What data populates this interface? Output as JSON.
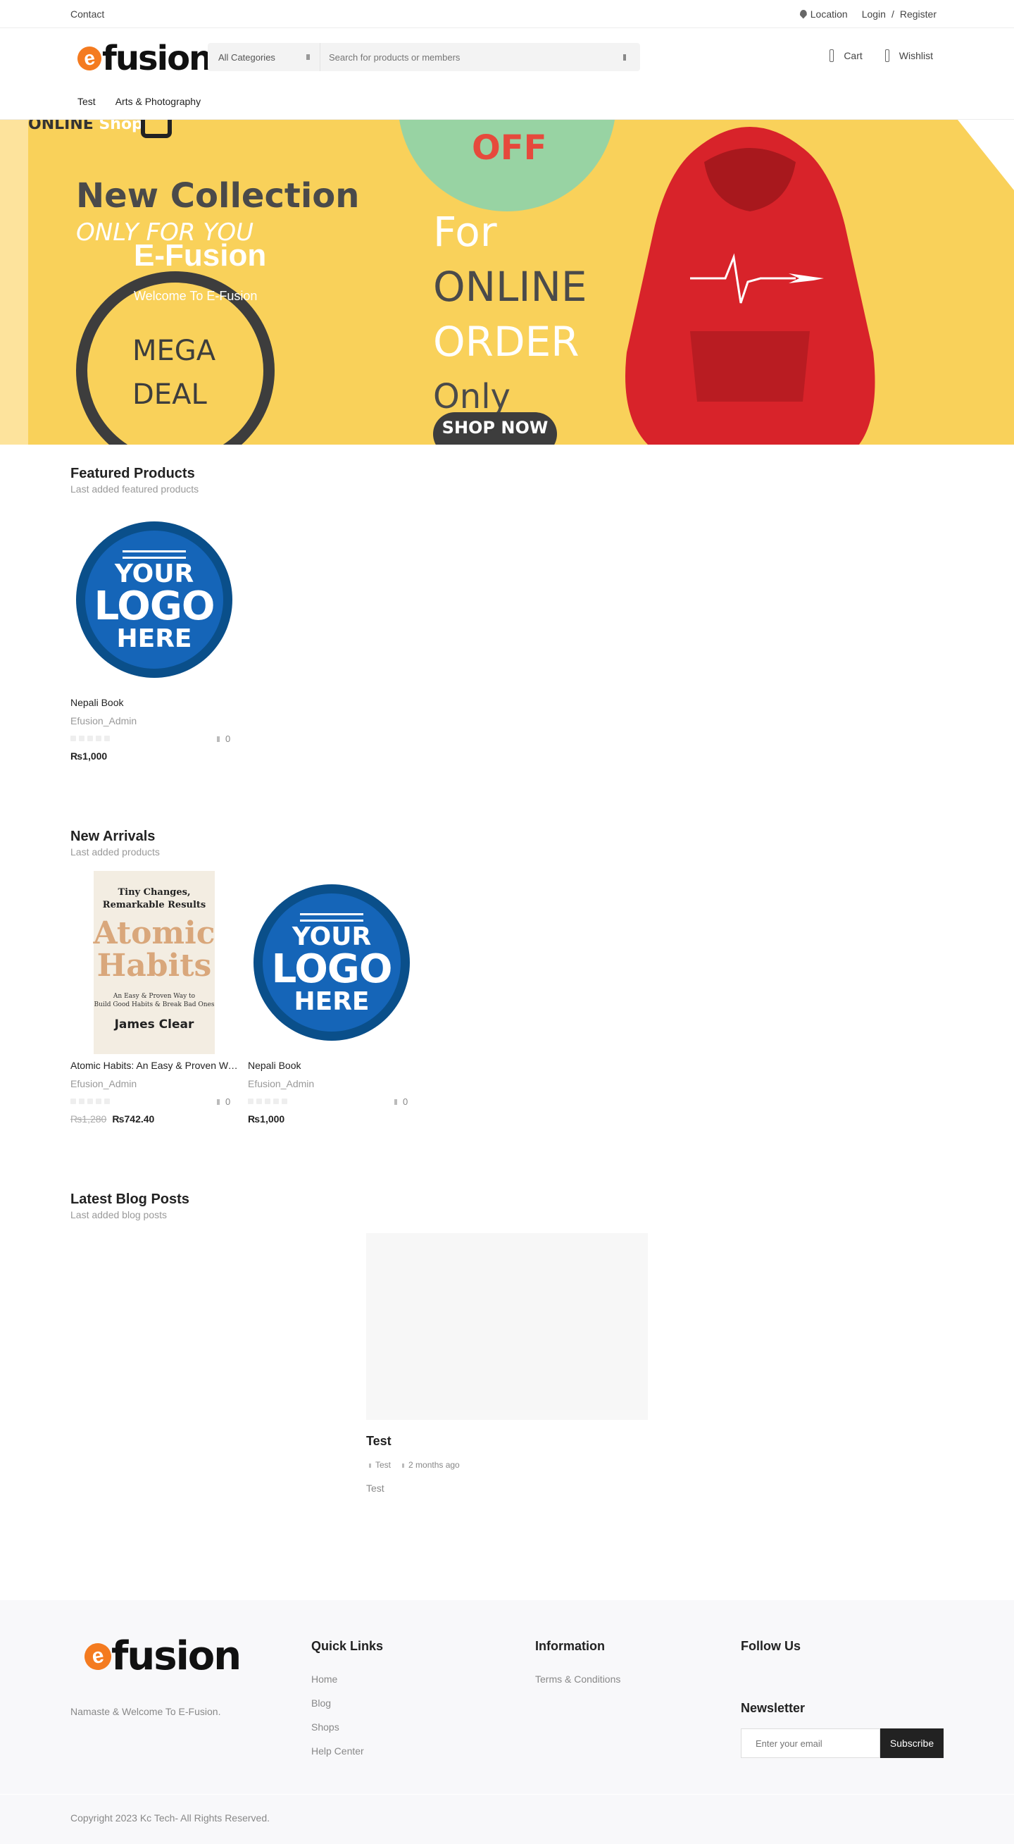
{
  "topbar": {
    "contact": "Contact",
    "location": "Location",
    "login": "Login",
    "separator": "/",
    "register": "Register"
  },
  "header": {
    "logo_e": "e",
    "logo_rest": "fusion",
    "search_category": "All Categories",
    "search_placeholder": "Search for products or members",
    "cart": "Cart",
    "wishlist": "Wishlist"
  },
  "nav": [
    "Test",
    "Arts & Photography"
  ],
  "hero": {
    "banner_online": "ONLINE",
    "banner_shop": "Shop",
    "banner_new_collection": "New Collection",
    "banner_only_for_you": "ONLY FOR YOU",
    "banner_mega": "MEGA",
    "banner_deal": "DEAL",
    "banner_off": "OFF",
    "banner_for": "For",
    "banner_online_word": "ONLINE",
    "banner_order": "ORDER",
    "banner_only": "Only",
    "banner_shop_now": "SHOP NOW",
    "title": "E-Fusion",
    "subtitle": "Welcome To E-Fusion"
  },
  "featured": {
    "title": "Featured Products",
    "subtitle": "Last added featured products",
    "products": [
      {
        "name": "Nepali Book",
        "vendor": "Efusion_Admin",
        "likes": "0",
        "price": "₨1,000",
        "image_text": [
          "YOUR",
          "LOGO",
          "HERE"
        ]
      }
    ]
  },
  "arrivals": {
    "title": "New Arrivals",
    "subtitle": "Last added products",
    "products": [
      {
        "name": "Atomic Habits: An Easy & Proven Way to Build Good Habits & Break Bad Ones",
        "vendor": "Efusion_Admin",
        "likes": "0",
        "old_price": "₨1,280",
        "price": "₨742.40",
        "book": {
          "line1": "Tiny Changes,",
          "line2": "Remarkable Results",
          "title1": "Atomic",
          "title2": "Habits",
          "sub1": "An Easy & Proven Way to",
          "sub2": "Build Good Habits & Break Bad Ones",
          "author": "James Clear"
        }
      },
      {
        "name": "Nepali Book",
        "vendor": "Efusion_Admin",
        "likes": "0",
        "price": "₨1,000",
        "image_text": [
          "YOUR",
          "LOGO",
          "HERE"
        ]
      }
    ]
  },
  "blog": {
    "title": "Latest Blog Posts",
    "subtitle": "Last added blog posts",
    "post": {
      "title": "Test",
      "category": "Test",
      "date": "2 months ago",
      "excerpt": "Test"
    }
  },
  "footer": {
    "tagline": "Namaste & Welcome To E-Fusion.",
    "quick_links_title": "Quick Links",
    "quick_links": [
      "Home",
      "Blog",
      "Shops",
      "Help Center"
    ],
    "information_title": "Information",
    "information_links": [
      "Terms & Conditions"
    ],
    "follow_title": "Follow Us",
    "newsletter_title": "Newsletter",
    "newsletter_placeholder": "Enter your email",
    "subscribe": "Subscribe",
    "copyright": "Copyright 2023 Kc Tech- All Rights Reserved."
  },
  "colors": {
    "accent": "#f47b20",
    "hero_bg": "#f9d15a",
    "hoodie": "#d8232a",
    "badge": "#98d3a3"
  }
}
